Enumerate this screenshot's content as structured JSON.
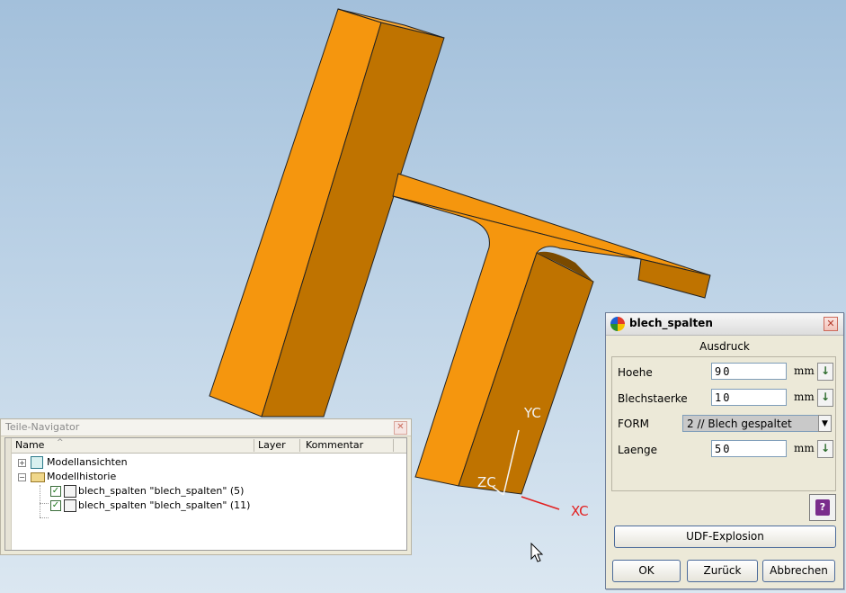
{
  "viewport": {
    "part_color": "#f5960e",
    "part_shade": "#bf7300",
    "axis_labels": {
      "y": "YC",
      "z": "ZC",
      "x": "XC"
    }
  },
  "navigator": {
    "title": "Teile-Navigator",
    "columns": {
      "name": "Name",
      "layer": "Layer",
      "comment": "Kommentar"
    },
    "items": [
      {
        "label": "Modellansichten",
        "icon": "model-views-icon",
        "expander": "+"
      },
      {
        "label": "Modellhistorie",
        "icon": "folder-open-icon",
        "expander": "−"
      },
      {
        "label": "blech_spalten \"blech_spalten\" (5)",
        "icon": "udf-feature-icon",
        "checked": true
      },
      {
        "label": "blech_spalten \"blech_spalten\" (11)",
        "icon": "udf-feature-icon",
        "checked": true
      }
    ]
  },
  "dialog": {
    "title": "blech_spalten",
    "section": "Ausdruck",
    "params": [
      {
        "label": "Hoehe",
        "value": "90",
        "unit": "mm"
      },
      {
        "label": "Blechstaerke",
        "value": "10",
        "unit": "mm"
      },
      {
        "label": "FORM",
        "value": "2 // Blech gespaltet"
      },
      {
        "label": "Laenge",
        "value": "50",
        "unit": "mm"
      }
    ],
    "udf_button": "UDF-Explosion",
    "ok_button": "OK",
    "back_button": "Zurück",
    "cancel_button": "Abbrechen"
  }
}
